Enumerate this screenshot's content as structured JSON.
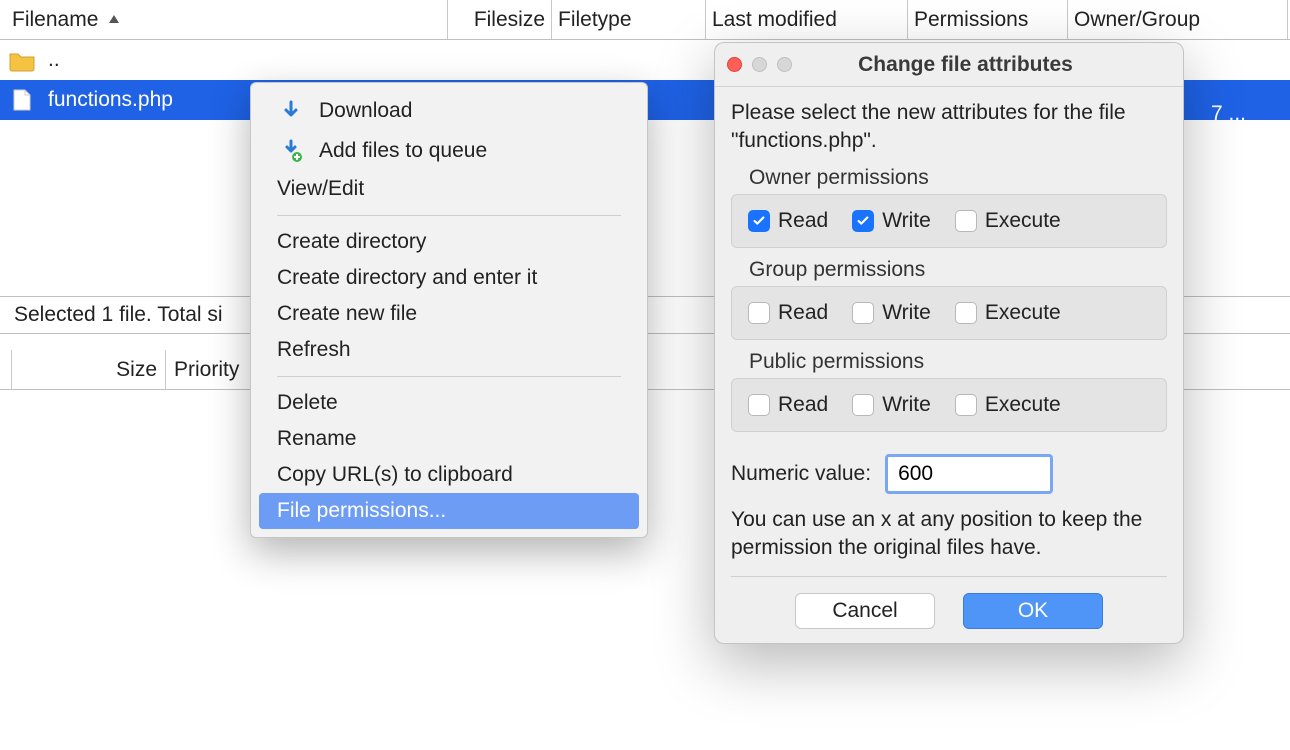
{
  "columns": {
    "filename": "Filename",
    "filesize": "Filesize",
    "filetype": "Filetype",
    "lastmod": "Last modified",
    "permissions": "Permissions",
    "owner": "Owner/Group"
  },
  "rows": {
    "parent": "..",
    "file1": "functions.php",
    "file1_trailing": "7 ..."
  },
  "status": "Selected 1 file. Total si",
  "queue_cols": {
    "size": "Size",
    "priority": "Priority"
  },
  "context_menu": {
    "download": "Download",
    "add_queue": "Add files to queue",
    "view_edit": "View/Edit",
    "create_dir": "Create directory",
    "create_dir_enter": "Create directory and enter it",
    "create_file": "Create new file",
    "refresh": "Refresh",
    "delete": "Delete",
    "rename": "Rename",
    "copy_url": "Copy URL(s) to clipboard",
    "file_perms": "File permissions..."
  },
  "dialog": {
    "title": "Change file attributes",
    "instruction": "Please select the new attributes for the file \"functions.php\".",
    "owner_label": "Owner permissions",
    "group_label": "Group permissions",
    "public_label": "Public permissions",
    "read": "Read",
    "write": "Write",
    "execute": "Execute",
    "numeric_label": "Numeric value:",
    "numeric_value": "600",
    "hint": "You can use an x at any position to keep the permission the original files have.",
    "cancel": "Cancel",
    "ok": "OK",
    "perms": {
      "owner": {
        "read": true,
        "write": true,
        "execute": false
      },
      "group": {
        "read": false,
        "write": false,
        "execute": false
      },
      "public": {
        "read": false,
        "write": false,
        "execute": false
      }
    }
  }
}
